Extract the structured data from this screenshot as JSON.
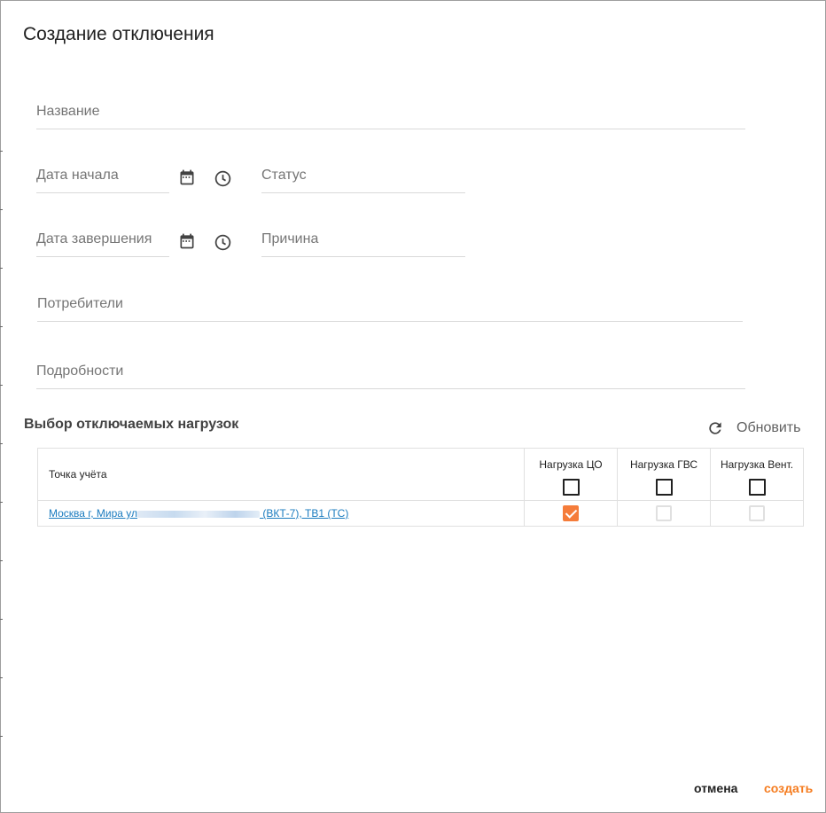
{
  "dialog": {
    "title": "Создание отключения"
  },
  "form": {
    "name_placeholder": "Название",
    "start_date_placeholder": "Дата начала",
    "status_placeholder": "Статус",
    "end_date_placeholder": "Дата завершения",
    "reason_placeholder": "Причина",
    "consumers_placeholder": "Потребители",
    "details_placeholder": "Подробности",
    "icons": [
      "calendar-icon",
      "clock-icon",
      "refresh-icon"
    ]
  },
  "loads_section": {
    "title": "Выбор отключаемых нагрузок",
    "refresh_label": "Обновить"
  },
  "table": {
    "columns": [
      "Точка учёта",
      "Нагрузка ЦО",
      "Нагрузка ГВС",
      "Нагрузка Вент."
    ],
    "rows": [
      {
        "point_prefix": "Москва г, Мира ул",
        "point_suffix": " (ВКТ-7), ТВ1 (ТС)",
        "load_co": true,
        "load_gvs": false,
        "load_vent": false
      }
    ]
  },
  "footer": {
    "cancel_label": "отмена",
    "create_label": "создать"
  },
  "colors": {
    "accent": "#f57c1f",
    "link": "#1a7bbf",
    "checkbox_checked": "#f57c3a"
  }
}
